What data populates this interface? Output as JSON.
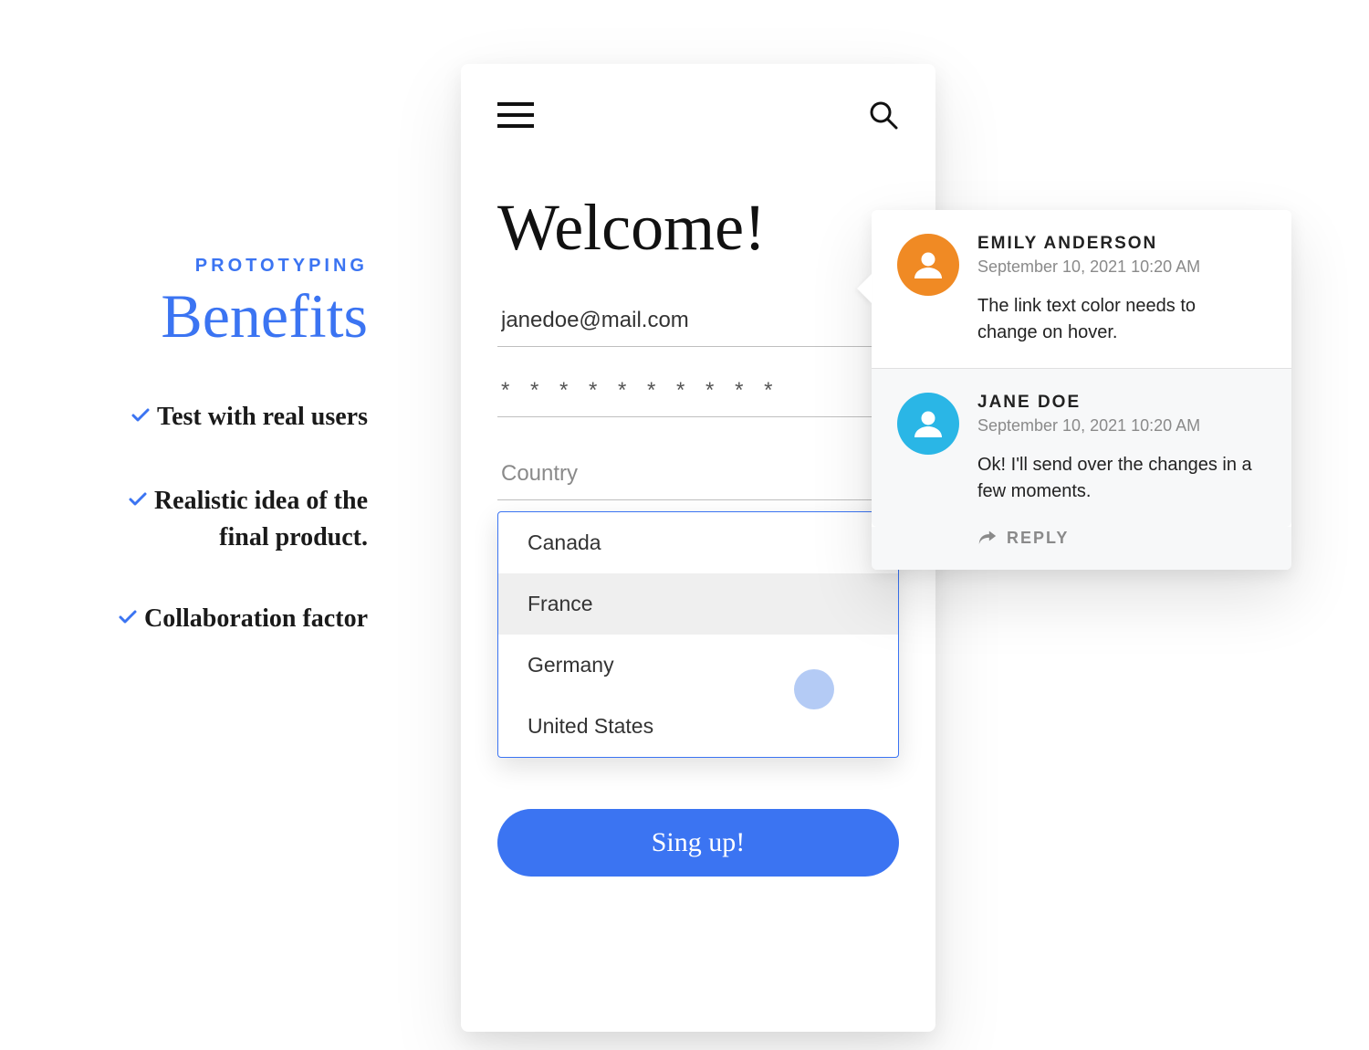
{
  "left": {
    "eyebrow": "PROTOTYPING",
    "heading": "Benefits",
    "items": [
      "Test with real users",
      "Realistic idea of the final product.",
      "Collaboration factor"
    ]
  },
  "phone": {
    "title": "Welcome!",
    "email": "janedoe@mail.com",
    "password_mask": "* * * * * * * * * *",
    "country_placeholder": "Country",
    "options": [
      "Canada",
      "France",
      "Germany",
      "United States"
    ],
    "highlighted_option_index": 1,
    "signup_label": "Sing up!"
  },
  "comments": {
    "items": [
      {
        "name": "EMILY ANDERSON",
        "time": "September 10, 2021 10:20 AM",
        "text": "The link text color needs to change on hover."
      },
      {
        "name": "JANE DOE",
        "time": "September 10, 2021 10:20 AM",
        "text": "Ok! I'll send over the changes in a few moments."
      }
    ],
    "reply_label": "REPLY"
  },
  "colors": {
    "accent": "#3b74f2"
  }
}
